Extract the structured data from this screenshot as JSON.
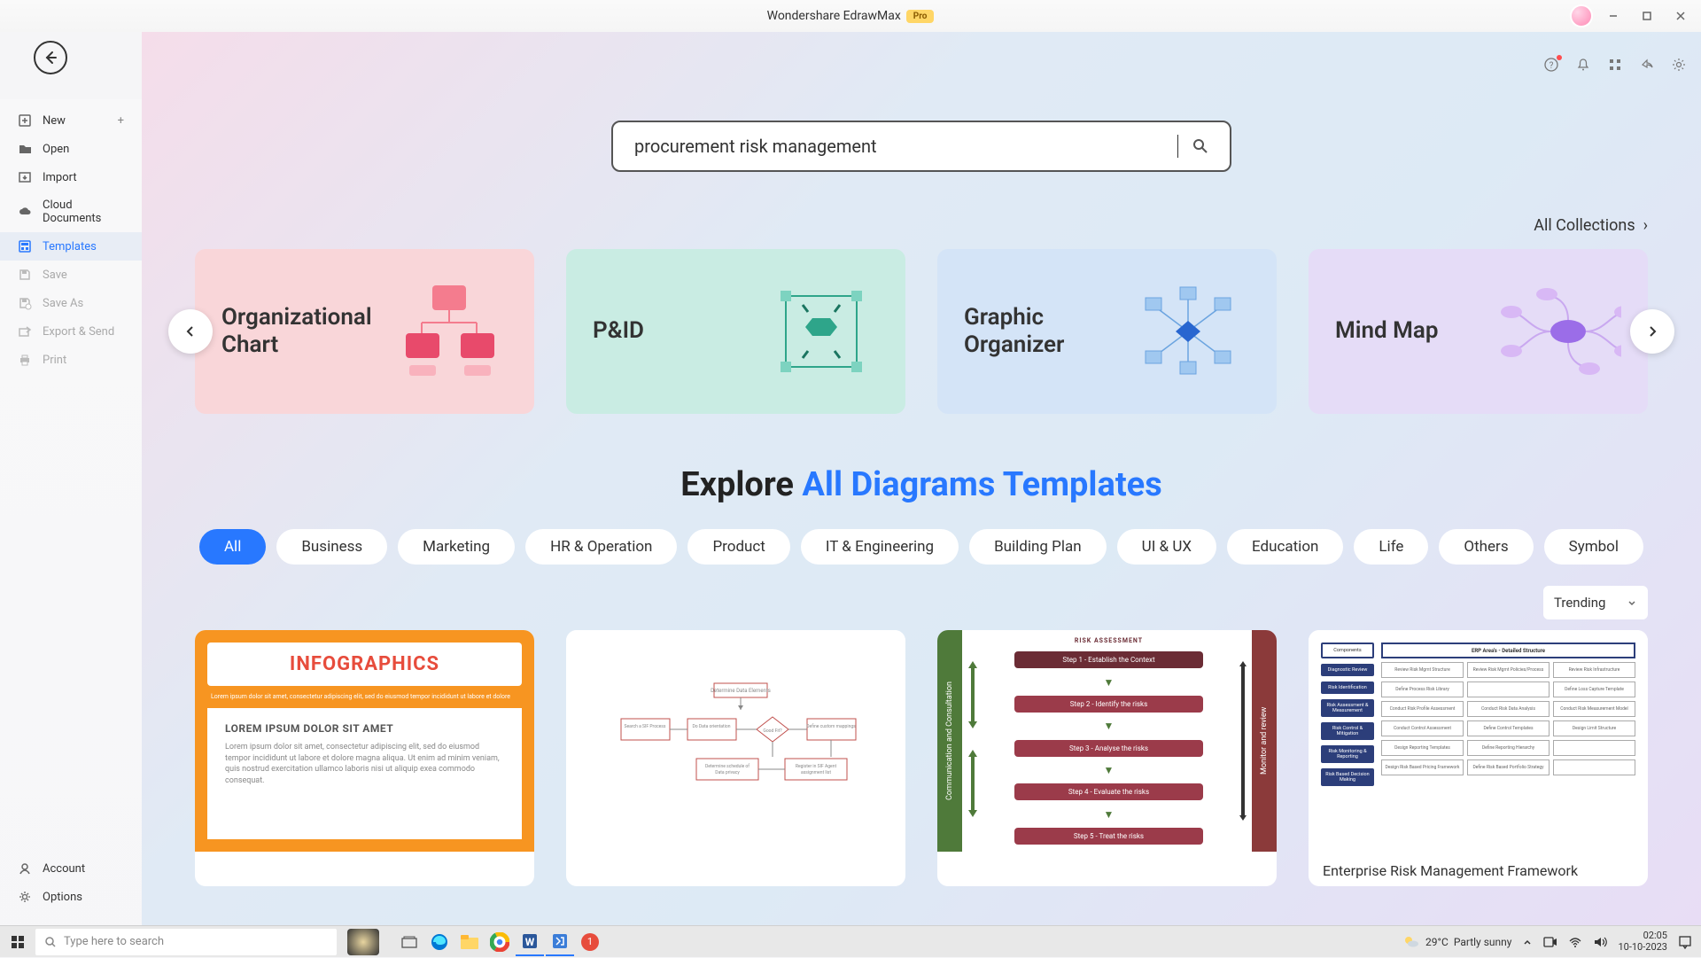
{
  "app": {
    "title": "Wondershare EdrawMax",
    "badge": "Pro"
  },
  "sidebar": {
    "items": [
      {
        "label": "New",
        "icon": "plus-square",
        "hasPlus": true
      },
      {
        "label": "Open",
        "icon": "folder"
      },
      {
        "label": "Import",
        "icon": "import"
      },
      {
        "label": "Cloud Documents",
        "icon": "cloud"
      },
      {
        "label": "Templates",
        "icon": "template",
        "active": true
      },
      {
        "label": "Save",
        "icon": "save",
        "disabled": true
      },
      {
        "label": "Save As",
        "icon": "save-as",
        "disabled": true
      },
      {
        "label": "Export & Send",
        "icon": "export",
        "disabled": true
      },
      {
        "label": "Print",
        "icon": "print",
        "disabled": true
      }
    ],
    "bottom": [
      {
        "label": "Account",
        "icon": "account"
      },
      {
        "label": "Options",
        "icon": "gear"
      }
    ]
  },
  "search": {
    "value": "procurement risk management"
  },
  "all_collections": "All Collections",
  "categories": [
    {
      "title": "Organizational\nChart",
      "color": "pink"
    },
    {
      "title": "P&ID",
      "color": "teal"
    },
    {
      "title": "Graphic\nOrganizer",
      "color": "blue"
    },
    {
      "title": "Mind Map",
      "color": "purple"
    }
  ],
  "explore": {
    "prefix": "Explore ",
    "highlight": "All Diagrams Templates"
  },
  "chips": [
    {
      "label": "All",
      "active": true
    },
    {
      "label": "Business"
    },
    {
      "label": "Marketing"
    },
    {
      "label": "HR & Operation"
    },
    {
      "label": "Product"
    },
    {
      "label": "IT & Engineering"
    },
    {
      "label": "Building Plan"
    },
    {
      "label": "UI & UX"
    },
    {
      "label": "Education"
    },
    {
      "label": "Life"
    },
    {
      "label": "Others"
    },
    {
      "label": "Symbol"
    }
  ],
  "sort": {
    "selected": "Trending"
  },
  "templates": [
    {
      "kind": "infographics",
      "banner": "INFOGRAPHICS",
      "title": "LOREM IPSUM DOLOR SIT AMET",
      "body": "Lorem ipsum dolor sit amet, consectetur adipiscing elit, sed do eiusmod tempor incididunt ut labore et dolore magna aliqua. Ut enim ad minim veniam, quis nostrud exercitation ullamco laboris nisi ut aliquip exea commodo consequat.",
      "strip": "Lorem ipsum dolor sit amet, consectetur adipiscing elit, sed do eiusmod tempor incididunt ut labore et dolore"
    },
    {
      "kind": "flowchart"
    },
    {
      "kind": "risk",
      "side_left": "Communication and Consultation",
      "side_right": "Monitor and review",
      "heading": "RISK ASSESSMENT",
      "steps": [
        "Step 1 - Establish the Context",
        "Step 2 - Identify the risks",
        "Step 3 - Analyse the risks",
        "Step 4 - Evaluate the risks",
        "Step 5 - Treat the risks"
      ]
    },
    {
      "kind": "erp",
      "caption": "Enterprise Risk Management Framework",
      "col_header": "Components",
      "grid_header": "ERP Area's - Detailed Structure"
    }
  ],
  "taskbar": {
    "search_placeholder": "Type here to search",
    "weather_temp": "29°C",
    "weather_desc": "Partly sunny",
    "time": "02:05",
    "date": "10-10-2023"
  }
}
